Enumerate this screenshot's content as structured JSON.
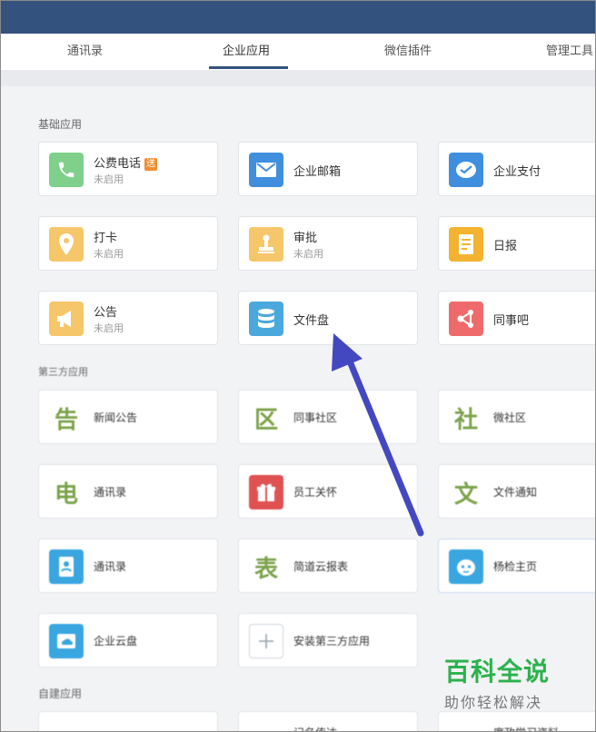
{
  "tabs": [
    {
      "label": "通讯录"
    },
    {
      "label": "企业应用"
    },
    {
      "label": "微信插件"
    },
    {
      "label": "管理工具"
    }
  ],
  "sections": {
    "basic": "基础应用",
    "third_party": "第三方应用",
    "custom": "自建应用"
  },
  "basic_apps": [
    {
      "name": "公费电话",
      "badge": "送",
      "status": "未启用",
      "icon": "phone-icon",
      "color": "#7fd08a"
    },
    {
      "name": "企业邮箱",
      "icon": "mail-icon",
      "color": "#3f8fde"
    },
    {
      "name": "企业支付",
      "icon": "payment-icon",
      "color": "#3f8fde"
    },
    {
      "name": "打卡",
      "status": "未启用",
      "icon": "location-pin-icon",
      "color": "#f6c66a"
    },
    {
      "name": "审批",
      "status": "未启用",
      "icon": "stamp-icon",
      "color": "#f6c66a"
    },
    {
      "name": "日报",
      "icon": "report-icon",
      "color": "#f3b330"
    },
    {
      "name": "公告",
      "status": "未启用",
      "icon": "megaphone-icon",
      "color": "#f6c66a"
    },
    {
      "name": "文件盘",
      "icon": "database-icon",
      "color": "#4aa8dc"
    },
    {
      "name": "同事吧",
      "icon": "share-network-icon",
      "color": "#ef6b6b"
    }
  ],
  "third_party_apps": [
    {
      "name": "新闻公告",
      "glyph": "告"
    },
    {
      "name": "同事社区",
      "glyph": "区"
    },
    {
      "name": "微社区",
      "glyph": "社"
    },
    {
      "name": "通讯录",
      "glyph": "电"
    },
    {
      "name": "员工关怀",
      "icon": "gift-icon",
      "color": "#e05252"
    },
    {
      "name": "文件通知",
      "glyph": "文"
    },
    {
      "name": "通讯录",
      "icon": "contacts-icon",
      "color": "#3aa6e0"
    },
    {
      "name": "简道云报表",
      "glyph": "表"
    },
    {
      "name": "杨检主页",
      "icon": "mascot-icon",
      "color": "#3aa6e0"
    },
    {
      "name": "企业云盘",
      "icon": "cloud-disk-icon",
      "color": "#3aa6e0"
    },
    {
      "name": "安装第三方应用",
      "icon": "plus-icon",
      "color": "#ffffff"
    }
  ],
  "custom_apps_partial": [
    {
      "name": "记名传达"
    },
    {
      "name": "廉政学习资料"
    }
  ],
  "watermark": {
    "title": "百科全说",
    "subtitle": "助你轻松解决"
  },
  "colors": {
    "topbar": "#34527e",
    "arrow": "#4448c0",
    "watermark_green": "#2bb24c"
  }
}
